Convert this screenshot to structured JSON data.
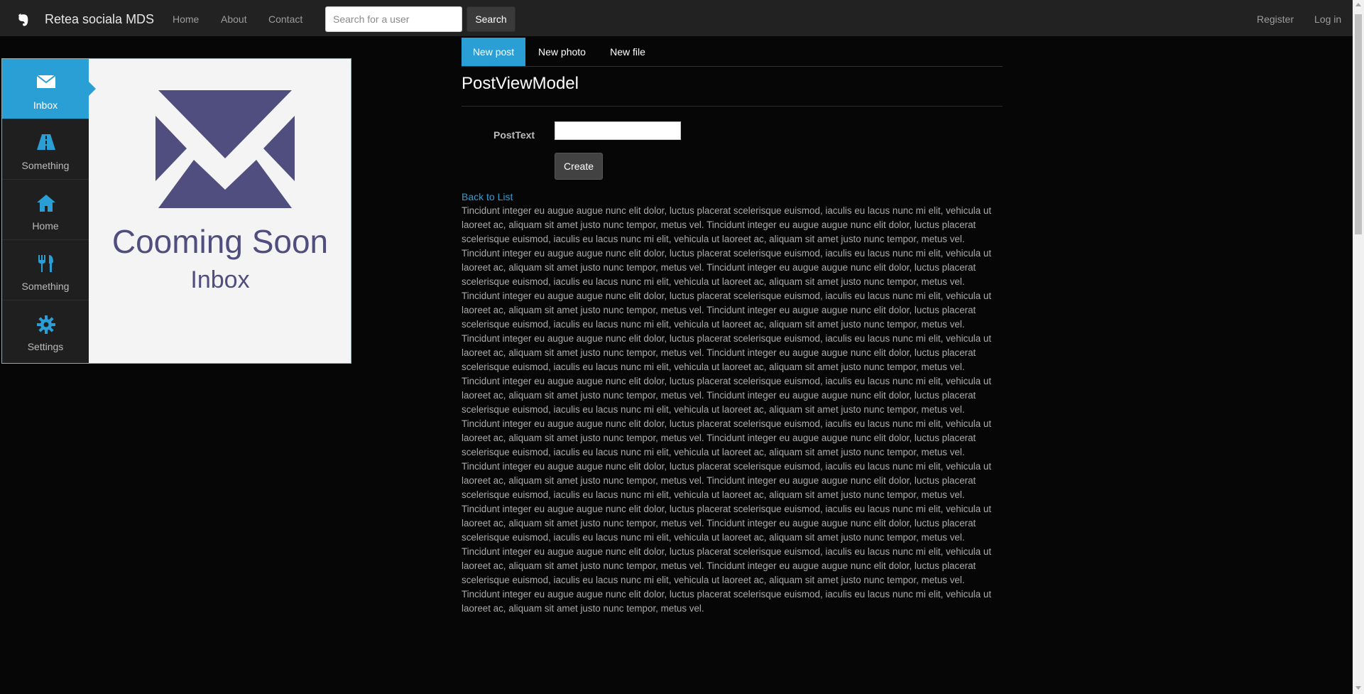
{
  "navbar": {
    "brand": "Retea sociala MDS",
    "links": [
      "Home",
      "About",
      "Contact"
    ],
    "search_placeholder": "Search for a user",
    "search_button": "Search",
    "right_links": [
      "Register",
      "Log in"
    ]
  },
  "side_menu": {
    "items": [
      {
        "label": "Inbox",
        "icon": "envelope-icon"
      },
      {
        "label": "Something",
        "icon": "road-icon"
      },
      {
        "label": "Home",
        "icon": "home-icon"
      },
      {
        "label": "Something",
        "icon": "cutlery-icon"
      },
      {
        "label": "Settings",
        "icon": "gear-icon"
      }
    ],
    "active_index": 0
  },
  "panel": {
    "title": "Cooming Soon",
    "subtitle": "Inbox"
  },
  "tabs": [
    "New post",
    "New photo",
    "New file"
  ],
  "form": {
    "title": "PostViewModel",
    "field_label": "PostText",
    "field_value": "",
    "create_button": "Create",
    "back_link": "Back to List"
  },
  "body_text": "Tincidunt integer eu augue augue nunc elit dolor, luctus placerat scelerisque euismod, iaculis eu lacus nunc mi elit, vehicula ut laoreet ac, aliquam sit amet justo nunc tempor, metus vel. Tincidunt integer eu augue augue nunc elit dolor, luctus placerat scelerisque euismod, iaculis eu lacus nunc mi elit, vehicula ut laoreet ac, aliquam sit amet justo nunc tempor, metus vel. Tincidunt integer eu augue augue nunc elit dolor, luctus placerat scelerisque euismod, iaculis eu lacus nunc mi elit, vehicula ut laoreet ac, aliquam sit amet justo nunc tempor, metus vel. Tincidunt integer eu augue augue nunc elit dolor, luctus placerat scelerisque euismod, iaculis eu lacus nunc mi elit, vehicula ut laoreet ac, aliquam sit amet justo nunc tempor, metus vel. Tincidunt integer eu augue augue nunc elit dolor, luctus placerat scelerisque euismod, iaculis eu lacus nunc mi elit, vehicula ut laoreet ac, aliquam sit amet justo nunc tempor, metus vel. Tincidunt integer eu augue augue nunc elit dolor, luctus placerat scelerisque euismod, iaculis eu lacus nunc mi elit, vehicula ut laoreet ac, aliquam sit amet justo nunc tempor, metus vel. Tincidunt integer eu augue augue nunc elit dolor, luctus placerat scelerisque euismod, iaculis eu lacus nunc mi elit, vehicula ut laoreet ac, aliquam sit amet justo nunc tempor, metus vel. Tincidunt integer eu augue augue nunc elit dolor, luctus placerat scelerisque euismod, iaculis eu lacus nunc mi elit, vehicula ut laoreet ac, aliquam sit amet justo nunc tempor, metus vel. Tincidunt integer eu augue augue nunc elit dolor, luctus placerat scelerisque euismod, iaculis eu lacus nunc mi elit, vehicula ut laoreet ac, aliquam sit amet justo nunc tempor, metus vel. Tincidunt integer eu augue augue nunc elit dolor, luctus placerat scelerisque euismod, iaculis eu lacus nunc mi elit, vehicula ut laoreet ac, aliquam sit amet justo nunc tempor, metus vel. Tincidunt integer eu augue augue nunc elit dolor, luctus placerat scelerisque euismod, iaculis eu lacus nunc mi elit, vehicula ut laoreet ac, aliquam sit amet justo nunc tempor, metus vel. Tincidunt integer eu augue augue nunc elit dolor, luctus placerat scelerisque euismod, iaculis eu lacus nunc mi elit, vehicula ut laoreet ac, aliquam sit amet justo nunc tempor, metus vel. Tincidunt integer eu augue augue nunc elit dolor, luctus placerat scelerisque euismod, iaculis eu lacus nunc mi elit, vehicula ut laoreet ac, aliquam sit amet justo nunc tempor, metus vel. Tincidunt integer eu augue augue nunc elit dolor, luctus placerat scelerisque euismod, iaculis eu lacus nunc mi elit, vehicula ut laoreet ac, aliquam sit amet justo nunc tempor, metus vel. Tincidunt integer eu augue augue nunc elit dolor, luctus placerat scelerisque euismod, iaculis eu lacus nunc mi elit, vehicula ut laoreet ac, aliquam sit amet justo nunc tempor, metus vel. Tincidunt integer eu augue augue nunc elit dolor, luctus placerat scelerisque euismod, iaculis eu lacus nunc mi elit, vehicula ut laoreet ac, aliquam sit amet justo nunc tempor, metus vel. Tincidunt integer eu augue augue nunc elit dolor, luctus placerat scelerisque euismod, iaculis eu lacus nunc mi elit, vehicula ut laoreet ac, aliquam sit amet justo nunc tempor, metus vel. Tincidunt integer eu augue augue nunc elit dolor, luctus placerat scelerisque euismod, iaculis eu lacus nunc mi elit, vehicula ut laoreet ac, aliquam sit amet justo nunc tempor, metus vel. Tincidunt integer eu augue augue nunc elit dolor, luctus placerat scelerisque euismod, iaculis eu lacus nunc mi elit, vehicula ut laoreet ac, aliquam sit amet justo nunc tempor, metus vel.",
  "colors": {
    "accent": "#2a9fd6",
    "navbar_bg": "#222222",
    "page_bg": "#060606",
    "panel_text": "#4f4e7e"
  }
}
